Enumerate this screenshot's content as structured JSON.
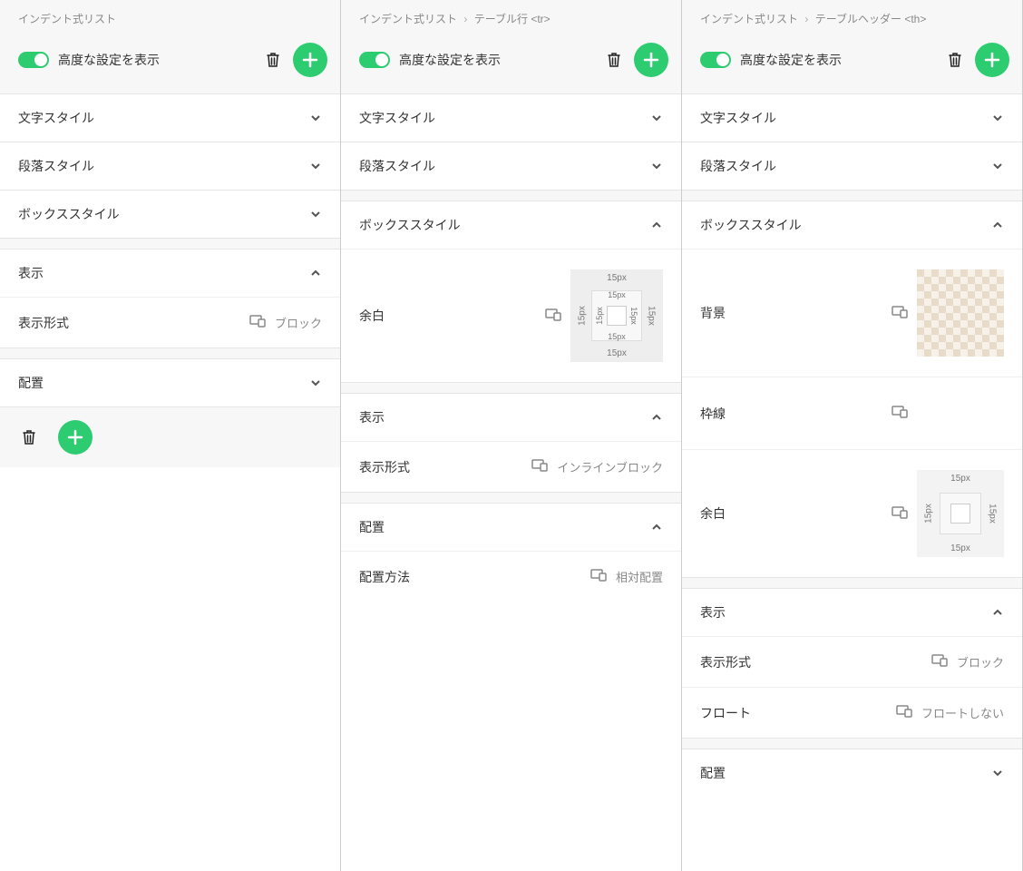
{
  "common": {
    "breadcrumb_root": "インデント式リスト",
    "toggle_label": "高度な設定を表示",
    "sections": {
      "text_style": "文字スタイル",
      "para_style": "段落スタイル",
      "box_style": "ボックススタイル",
      "display": "表示",
      "position": "配置"
    },
    "props": {
      "display_mode": "表示形式",
      "margin": "余白",
      "background": "背景",
      "border": "枠線",
      "float": "フロート",
      "position_method": "配置方法"
    },
    "values": {
      "block": "ブロック",
      "inline_block": "インラインブロック",
      "relative": "相対配置",
      "no_float": "フロートしない",
      "px15": "15px"
    }
  },
  "panel2": {
    "crumb2": "テーブル行 <tr>"
  },
  "panel3": {
    "crumb2": "テーブルヘッダー <th>"
  }
}
